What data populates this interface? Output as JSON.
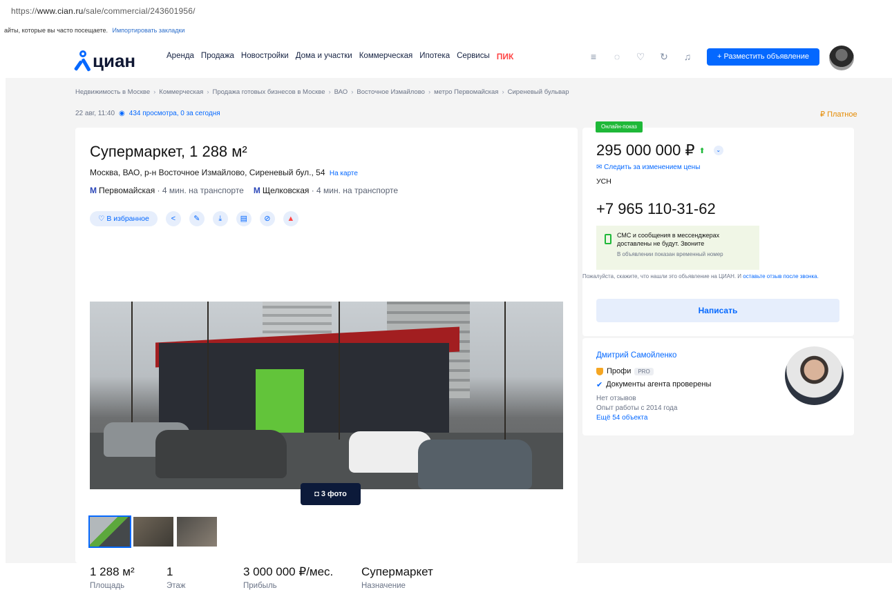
{
  "browser": {
    "url_prefix": "https://",
    "url_host": "www.cian.ru",
    "url_path": "/sale/commercial/243601956/",
    "bookmarks_text": "айты, которые вы часто посещаете.",
    "bookmarks_link": "Импортировать закладки"
  },
  "header": {
    "logo_text": "циан",
    "nav": [
      "Аренда",
      "Продажа",
      "Новостройки",
      "Дома и участки",
      "Коммерческая",
      "Ипотека",
      "Сервисы"
    ],
    "nav_pik": "ПИК",
    "post_button": "+ Разместить объявление",
    "icons": [
      "compare-icon",
      "chat-icon",
      "heart-icon",
      "refresh-icon",
      "bell-icon"
    ]
  },
  "breadcrumbs": [
    "Недвижимость в Москве",
    "Коммерческая",
    "Продажа готовых бизнесов в Москве",
    "ВАО",
    "Восточное Измайлово",
    "метро Первомайская",
    "Сиреневый бульвар"
  ],
  "meta": {
    "date": "22 авг, 11:40",
    "views": "434 просмотра, 0 за сегодня",
    "paid": "Платное"
  },
  "listing": {
    "title": "Супермаркет, 1 288 м²",
    "address": "Москва, ВАО, р-н Восточное Измайлово, Сиреневый бул., 54",
    "map_link": "На карте",
    "metro": [
      {
        "station": "Первомайская",
        "time": "· 4 мин. на транспорте"
      },
      {
        "station": "Щелковская",
        "time": "· 4 мин. на транспорте"
      }
    ],
    "favorite_label": "В избранное",
    "photo_count": "3 фото",
    "facts": [
      {
        "value": "1 288 м²",
        "label": "Площадь"
      },
      {
        "value": "1",
        "label": "Этаж"
      },
      {
        "value": "3 000 000 ₽/мес.",
        "label": "Прибыль"
      },
      {
        "value": "Супермаркет",
        "label": "Назначение"
      }
    ]
  },
  "sidebar": {
    "online_badge": "Онлайн-показ",
    "price": "295 000 000 ₽",
    "track_price": "Следить за изменением цены",
    "tax": "УСН",
    "phone": "+7 965 110-31-62",
    "sms_warning": "СМС и сообщения в мессенджерах доставлены не будут. Звоните",
    "temp_number": "В объявлении показан временный номер",
    "hint_text": "Пожалуйста, скажите, что нашли это объявление на ЦИАН. И",
    "hint_link": "оставьте отзыв после звонка.",
    "write_button": "Написать"
  },
  "agent": {
    "name": "Дмитрий Самойленко",
    "level": "Профи",
    "pro_badge": "PRO",
    "verified": "Документы агента проверены",
    "reviews": "Нет отзывов",
    "experience": "Опыт работы с 2014 года",
    "more": "Ещё 54 объекта"
  },
  "colors": {
    "brand": "#0468ff",
    "badge_green": "#1eb838",
    "pik": "#ff4545",
    "paid": "#e58a00"
  }
}
